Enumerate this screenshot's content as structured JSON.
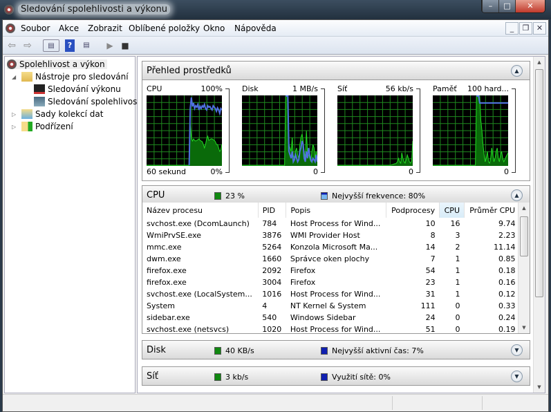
{
  "window": {
    "title": "Sledování spolehlivosti a výkonu",
    "controls": [
      "minimize",
      "maximize",
      "close"
    ]
  },
  "menu": [
    "Soubor",
    "Akce",
    "Zobrazit",
    "Oblíbené položky",
    "Okno",
    "Nápověda"
  ],
  "toolbar": [
    "back-icon",
    "forward-icon",
    "show-hide-console-tree-icon",
    "help-icon",
    "show-hide-action-pane-icon",
    "play-icon",
    "stop-icon"
  ],
  "tree": [
    {
      "label": "Spolehlivost a výkon",
      "selected": true
    },
    {
      "label": "Nástroje pro sledování",
      "expanded": true
    },
    {
      "label": "Sledování výkonu"
    },
    {
      "label": "Sledování spolehlivosti"
    },
    {
      "label": "Sady kolekcí dat",
      "expanded": false
    },
    {
      "label": "Podřízení",
      "expanded": false
    }
  ],
  "overview": {
    "title": "Přehled prostředků",
    "graphs": [
      {
        "name": "CPU",
        "max": "100%",
        "min": "0%",
        "bottom_left": "60 sekund",
        "green": [
          0,
          0,
          0,
          0,
          0,
          0,
          0,
          0,
          0,
          0,
          0,
          0,
          0,
          0,
          0,
          0,
          0,
          0,
          0,
          0,
          0,
          0,
          0,
          0,
          0,
          0,
          0,
          0,
          0,
          0,
          0,
          0,
          0,
          0,
          0,
          0,
          0,
          0,
          0,
          0,
          60,
          40,
          35,
          38,
          36,
          35,
          36,
          37,
          38,
          36,
          35,
          34,
          30,
          25,
          30,
          38,
          42,
          36,
          37,
          38,
          38,
          37,
          36,
          34,
          30,
          30,
          25,
          20,
          22,
          30
        ],
        "blue": [
          null,
          null,
          null,
          null,
          null,
          null,
          null,
          null,
          null,
          null,
          null,
          null,
          null,
          null,
          null,
          null,
          null,
          null,
          null,
          null,
          null,
          null,
          null,
          null,
          null,
          null,
          null,
          null,
          null,
          null,
          null,
          null,
          null,
          null,
          null,
          null,
          null,
          null,
          null,
          0,
          82,
          98,
          85,
          90,
          82,
          86,
          84,
          88,
          80,
          85,
          82,
          86,
          84,
          88,
          82,
          80,
          86,
          84,
          85,
          82,
          80,
          86,
          84,
          82,
          78,
          83,
          80,
          75,
          82,
          80
        ]
      },
      {
        "name": "Disk",
        "max": "1 MB/s",
        "min": "0",
        "bottom_left": "",
        "green": [
          0,
          0,
          0,
          0,
          0,
          0,
          0,
          0,
          0,
          0,
          0,
          0,
          0,
          0,
          0,
          0,
          0,
          0,
          0,
          0,
          0,
          0,
          0,
          0,
          0,
          0,
          0,
          0,
          0,
          0,
          0,
          0,
          0,
          0,
          0,
          0,
          0,
          0,
          0,
          0,
          100,
          100,
          100,
          30,
          25,
          20,
          40,
          15,
          10,
          20,
          25,
          15,
          10,
          30,
          40,
          45,
          35,
          20,
          10,
          50,
          20,
          15,
          10,
          5,
          20,
          30,
          25,
          10,
          20,
          5
        ],
        "blue": [
          null,
          null,
          null,
          null,
          null,
          null,
          null,
          null,
          null,
          null,
          null,
          null,
          null,
          null,
          null,
          null,
          null,
          null,
          null,
          null,
          null,
          null,
          null,
          null,
          null,
          null,
          null,
          null,
          null,
          null,
          null,
          null,
          null,
          null,
          null,
          null,
          null,
          null,
          null,
          null,
          100,
          100,
          100,
          20,
          15,
          10,
          20,
          5,
          8,
          15,
          10,
          5,
          8,
          20,
          25,
          35,
          30,
          10,
          5,
          20,
          10,
          25,
          15,
          8,
          5,
          10,
          8,
          5,
          15,
          5
        ]
      },
      {
        "name": "Síť",
        "max": "56 kb/s",
        "min": "0",
        "bottom_left": "",
        "green": [
          0,
          0,
          0,
          0,
          0,
          0,
          0,
          0,
          0,
          0,
          0,
          0,
          0,
          0,
          0,
          0,
          0,
          0,
          0,
          0,
          0,
          0,
          0,
          0,
          0,
          0,
          0,
          0,
          0,
          0,
          0,
          0,
          0,
          0,
          0,
          0,
          0,
          0,
          0,
          0,
          0,
          0,
          0,
          0,
          0,
          0,
          0,
          0,
          0,
          0,
          1,
          1,
          2,
          2,
          3,
          5,
          10,
          5,
          3,
          18,
          10,
          5,
          3,
          8,
          15,
          10,
          5,
          3,
          6,
          35
        ],
        "blue": []
      },
      {
        "name": "Paměť",
        "max": "100 hard...",
        "min": "0",
        "bottom_left": "",
        "green": [
          0,
          0,
          0,
          0,
          0,
          0,
          0,
          0,
          0,
          0,
          0,
          0,
          0,
          0,
          0,
          0,
          0,
          0,
          0,
          0,
          0,
          0,
          0,
          0,
          0,
          0,
          0,
          0,
          0,
          0,
          0,
          0,
          0,
          0,
          0,
          0,
          0,
          0,
          0,
          0,
          100,
          100,
          100,
          100,
          65,
          50,
          30,
          15,
          5,
          10,
          20,
          5,
          3,
          10,
          25,
          15,
          5,
          10,
          20,
          25,
          10,
          5,
          15,
          20,
          10,
          5,
          8,
          12,
          15,
          18
        ],
        "blue": [
          null,
          null,
          null,
          null,
          null,
          null,
          null,
          null,
          null,
          null,
          null,
          null,
          null,
          null,
          null,
          null,
          null,
          null,
          null,
          null,
          null,
          null,
          null,
          null,
          null,
          null,
          null,
          null,
          null,
          null,
          null,
          null,
          null,
          null,
          null,
          null,
          null,
          null,
          null,
          null,
          100,
          100,
          100,
          90,
          90,
          90,
          90,
          90,
          90,
          90,
          90,
          90,
          90,
          90,
          90,
          90,
          90,
          90,
          90,
          90,
          90,
          90,
          90,
          90,
          90,
          90,
          90,
          90,
          90,
          90
        ]
      }
    ]
  },
  "cpu": {
    "title": "CPU",
    "usage": "23 %",
    "secondary": "Nejvyšší frekvence: 80%",
    "columns": [
      "Název procesu",
      "PID",
      "Popis",
      "Podprocesy",
      "CPU",
      "Průměr CPU"
    ],
    "sorted_column": "CPU",
    "rows": [
      [
        "svchost.exe (DcomLaunch)",
        "784",
        "Host Process for Wind...",
        "10",
        "16",
        "9.74"
      ],
      [
        "WmiPrvSE.exe",
        "3876",
        "WMI Provider Host",
        "8",
        "3",
        "2.23"
      ],
      [
        "mmc.exe",
        "5264",
        "Konzola Microsoft Ma...",
        "14",
        "2",
        "11.14"
      ],
      [
        "dwm.exe",
        "1660",
        "Správce oken plochy",
        "7",
        "1",
        "0.85"
      ],
      [
        "firefox.exe",
        "2092",
        "Firefox",
        "54",
        "1",
        "0.18"
      ],
      [
        "firefox.exe",
        "3004",
        "Firefox",
        "23",
        "1",
        "0.16"
      ],
      [
        "svchost.exe (LocalSystem...",
        "1016",
        "Host Process for Wind...",
        "31",
        "1",
        "0.12"
      ],
      [
        "System",
        "4",
        "NT Kernel & System",
        "111",
        "0",
        "0.33"
      ],
      [
        "sidebar.exe",
        "540",
        "Windows Sidebar",
        "24",
        "0",
        "0.24"
      ],
      [
        "svchost.exe (netsvcs)",
        "1020",
        "Host Process for Wind...",
        "51",
        "0",
        "0.19"
      ]
    ]
  },
  "disk": {
    "title": "Disk",
    "usage": "40 KB/s",
    "secondary": "Nejvyšší aktivní čas: 7%"
  },
  "network": {
    "title": "Síť",
    "usage": "3 kb/s",
    "secondary": "Využití sítě: 0%"
  },
  "colors": {
    "graph_bg": "#000000",
    "grid": "#1f8a1f",
    "green": "#22dd22",
    "blue": "#4f70e0",
    "primary_swatch": "#118811",
    "secondary_swatch": "#1020b0"
  }
}
